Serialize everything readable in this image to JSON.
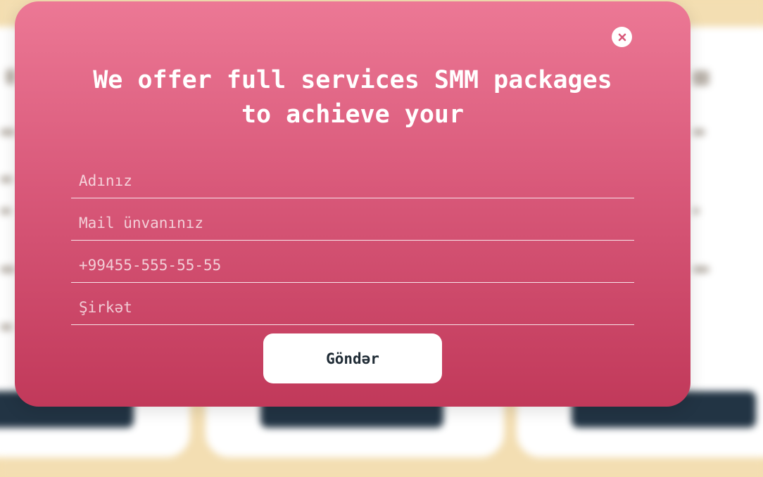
{
  "modal": {
    "title": "We offer full services SMM packages to achieve your",
    "close_icon": "close-icon",
    "fields": [
      {
        "placeholder": "Adınız",
        "value": ""
      },
      {
        "placeholder": "Mail ünvanınız",
        "value": ""
      },
      {
        "placeholder": "+99455-555-55-55",
        "value": ""
      },
      {
        "placeholder": "Şirkət",
        "value": ""
      }
    ],
    "submit_label": "Göndər"
  },
  "colors": {
    "modal_gradient_top": "#ec7895",
    "modal_gradient_bottom": "#c1395a",
    "accent_close": "#d9597a",
    "background": "#f3deb2",
    "background_buttons": "#223444"
  }
}
